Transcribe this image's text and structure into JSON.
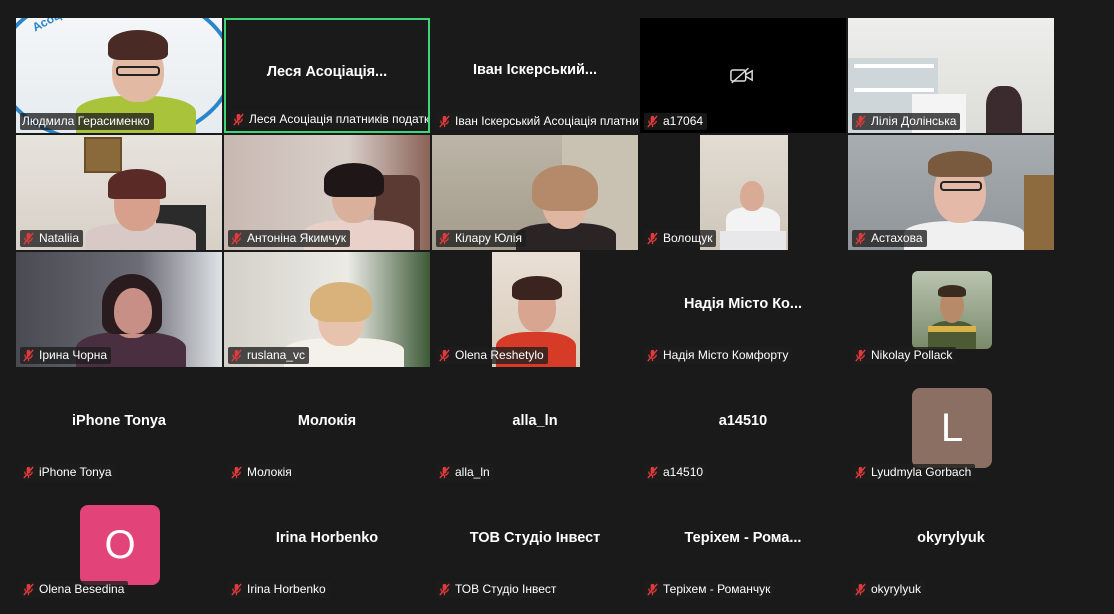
{
  "participants": [
    {
      "label": "Людмила Герасименко",
      "center": "",
      "logo_text": "Асоціація платників"
    },
    {
      "label": "Леся Асоціація платників податків",
      "center": "Леся Асоціація..."
    },
    {
      "label": "Іван Іскерський   Асоціація платників",
      "center": "Іван Іскерський..."
    },
    {
      "label": "a17064",
      "center": ""
    },
    {
      "label": "Лілія Долінська",
      "center": ""
    },
    {
      "label": "Nataliia",
      "center": ""
    },
    {
      "label": "Антоніна Якимчук",
      "center": ""
    },
    {
      "label": "Кілару Юлія",
      "center": ""
    },
    {
      "label": "Волощук",
      "center": ""
    },
    {
      "label": "Астахова",
      "center": ""
    },
    {
      "label": "Ірина Чорна",
      "center": ""
    },
    {
      "label": "ruslana_vc",
      "center": ""
    },
    {
      "label": "Olena Reshetylo",
      "center": ""
    },
    {
      "label": "Надія Місто Комфорту",
      "center": "Надія Місто Ко..."
    },
    {
      "label": "Nikolay Pollack",
      "center": ""
    },
    {
      "label": "iPhone Tonya",
      "center": "iPhone Tonya"
    },
    {
      "label": "Молокія",
      "center": "Молокія"
    },
    {
      "label": "alla_ln",
      "center": "alla_ln"
    },
    {
      "label": "a14510",
      "center": "a14510"
    },
    {
      "label": "Lyudmyla Gorbach",
      "center": "",
      "avatar_letter": "L",
      "avatar_color": "#8a6f62"
    },
    {
      "label": "Olena Besedina",
      "center": "",
      "avatar_letter": "O",
      "avatar_color": "#e2447a"
    },
    {
      "label": "Irina Horbenko",
      "center": "Irina Horbenko"
    },
    {
      "label": "ТОВ Студіо Інвест",
      "center": "ТОВ  Студіо Інвест"
    },
    {
      "label": "Теріхем - Романчук",
      "center": "Теріхем - Рома..."
    },
    {
      "label": "okyrylyuk",
      "center": "okyrylyuk"
    }
  ],
  "icons": {
    "muted_mic": "mic-off-icon",
    "video_off": "video-off-icon"
  },
  "colors": {
    "active_border": "#3dd674",
    "mic_muted": "#e03a3a",
    "background": "#1a1a1a"
  }
}
